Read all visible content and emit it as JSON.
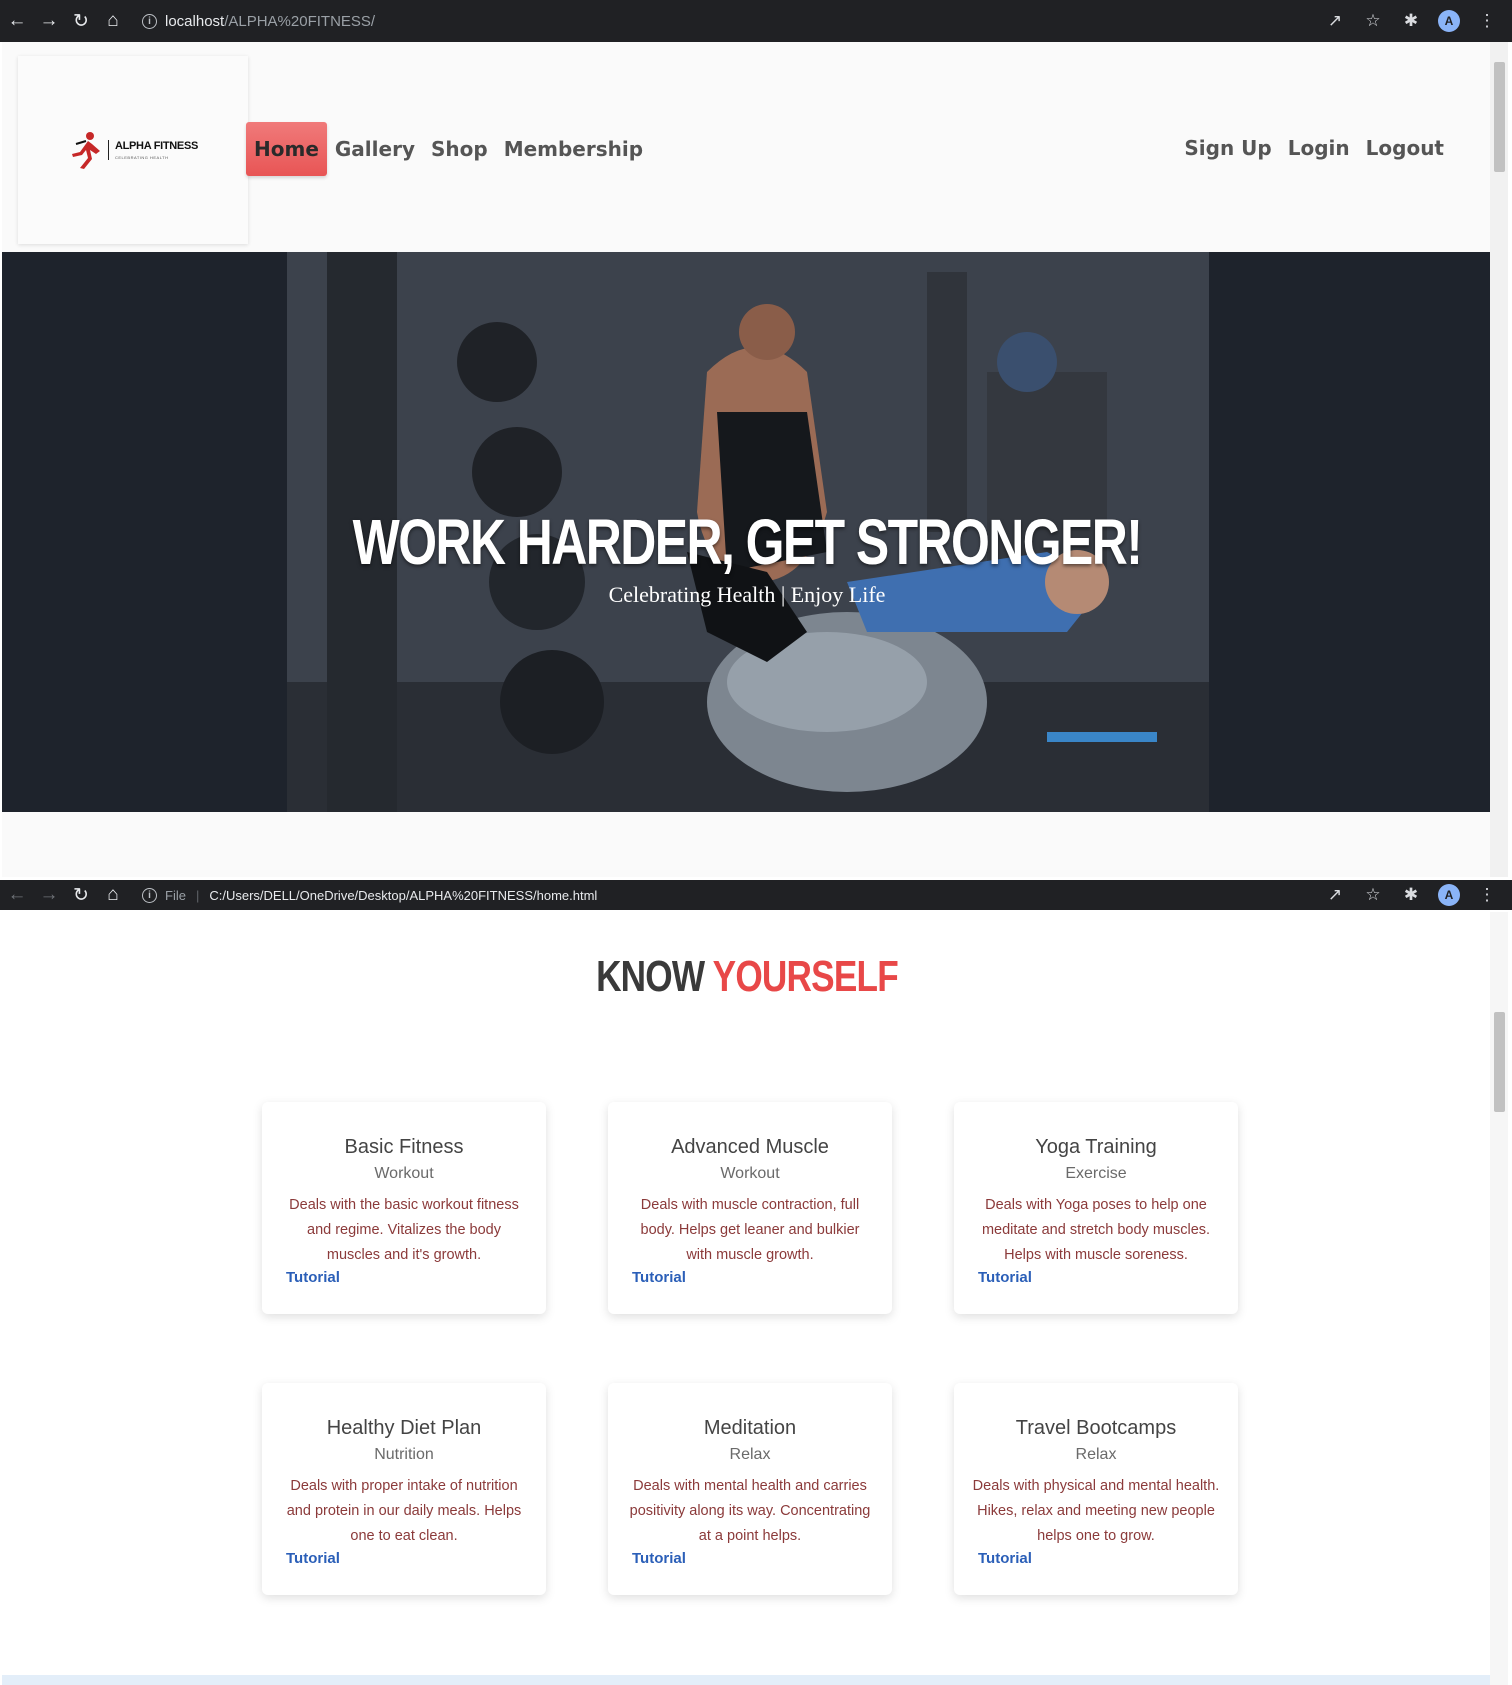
{
  "browser_top": {
    "url_host": "localhost",
    "url_path": "/ALPHA%20FITNESS/",
    "avatar_letter": "A"
  },
  "browser_bottom": {
    "file_label": "File",
    "url": "C:/Users/DELL/OneDrive/Desktop/ALPHA%20FITNESS/home.html",
    "avatar_letter": "A"
  },
  "logo": {
    "brand": "ALPHA FITNESS",
    "tagline": "CELEBRATING HEALTH"
  },
  "nav": {
    "left": [
      "Home",
      "Gallery",
      "Shop",
      "Membership"
    ],
    "right": [
      "Sign Up",
      "Login",
      "Logout"
    ],
    "active": "Home"
  },
  "hero": {
    "title": "WORK HARDER, GET STRONGER!",
    "subtitle": "Celebrating Health | Enjoy Life"
  },
  "section": {
    "title_word1": "KNOW",
    "title_word2": "YOURSELF"
  },
  "cards": [
    {
      "title": "Basic Fitness",
      "subtitle": "Workout",
      "description": "Deals with the basic workout fitness and regime. Vitalizes the body muscles and it's growth.",
      "link": "Tutorial"
    },
    {
      "title": "Advanced Muscle",
      "subtitle": "Workout",
      "description": "Deals with muscle contraction, full body. Helps get leaner and bulkier with muscle growth.",
      "link": "Tutorial"
    },
    {
      "title": "Yoga Training",
      "subtitle": "Exercise",
      "description": "Deals with Yoga poses to help one meditate and stretch body muscles. Helps with muscle soreness.",
      "link": "Tutorial"
    },
    {
      "title": "Healthy Diet Plan",
      "subtitle": "Nutrition",
      "description": "Deals with proper intake of nutrition and protein in our daily meals. Helps one to eat clean.",
      "link": "Tutorial"
    },
    {
      "title": "Meditation",
      "subtitle": "Relax",
      "description": "Deals with mental health and carries positivity along its way. Concentrating at a point helps.",
      "link": "Tutorial"
    },
    {
      "title": "Travel Bootcamps",
      "subtitle": "Relax",
      "description": "Deals with physical and mental health. Hikes, relax and meeting new people helps one to grow.",
      "link": "Tutorial"
    }
  ],
  "colors": {
    "accent": "#e84848",
    "link": "#2b5fb8",
    "description": "#8b3a3a",
    "chrome": "#202124"
  }
}
